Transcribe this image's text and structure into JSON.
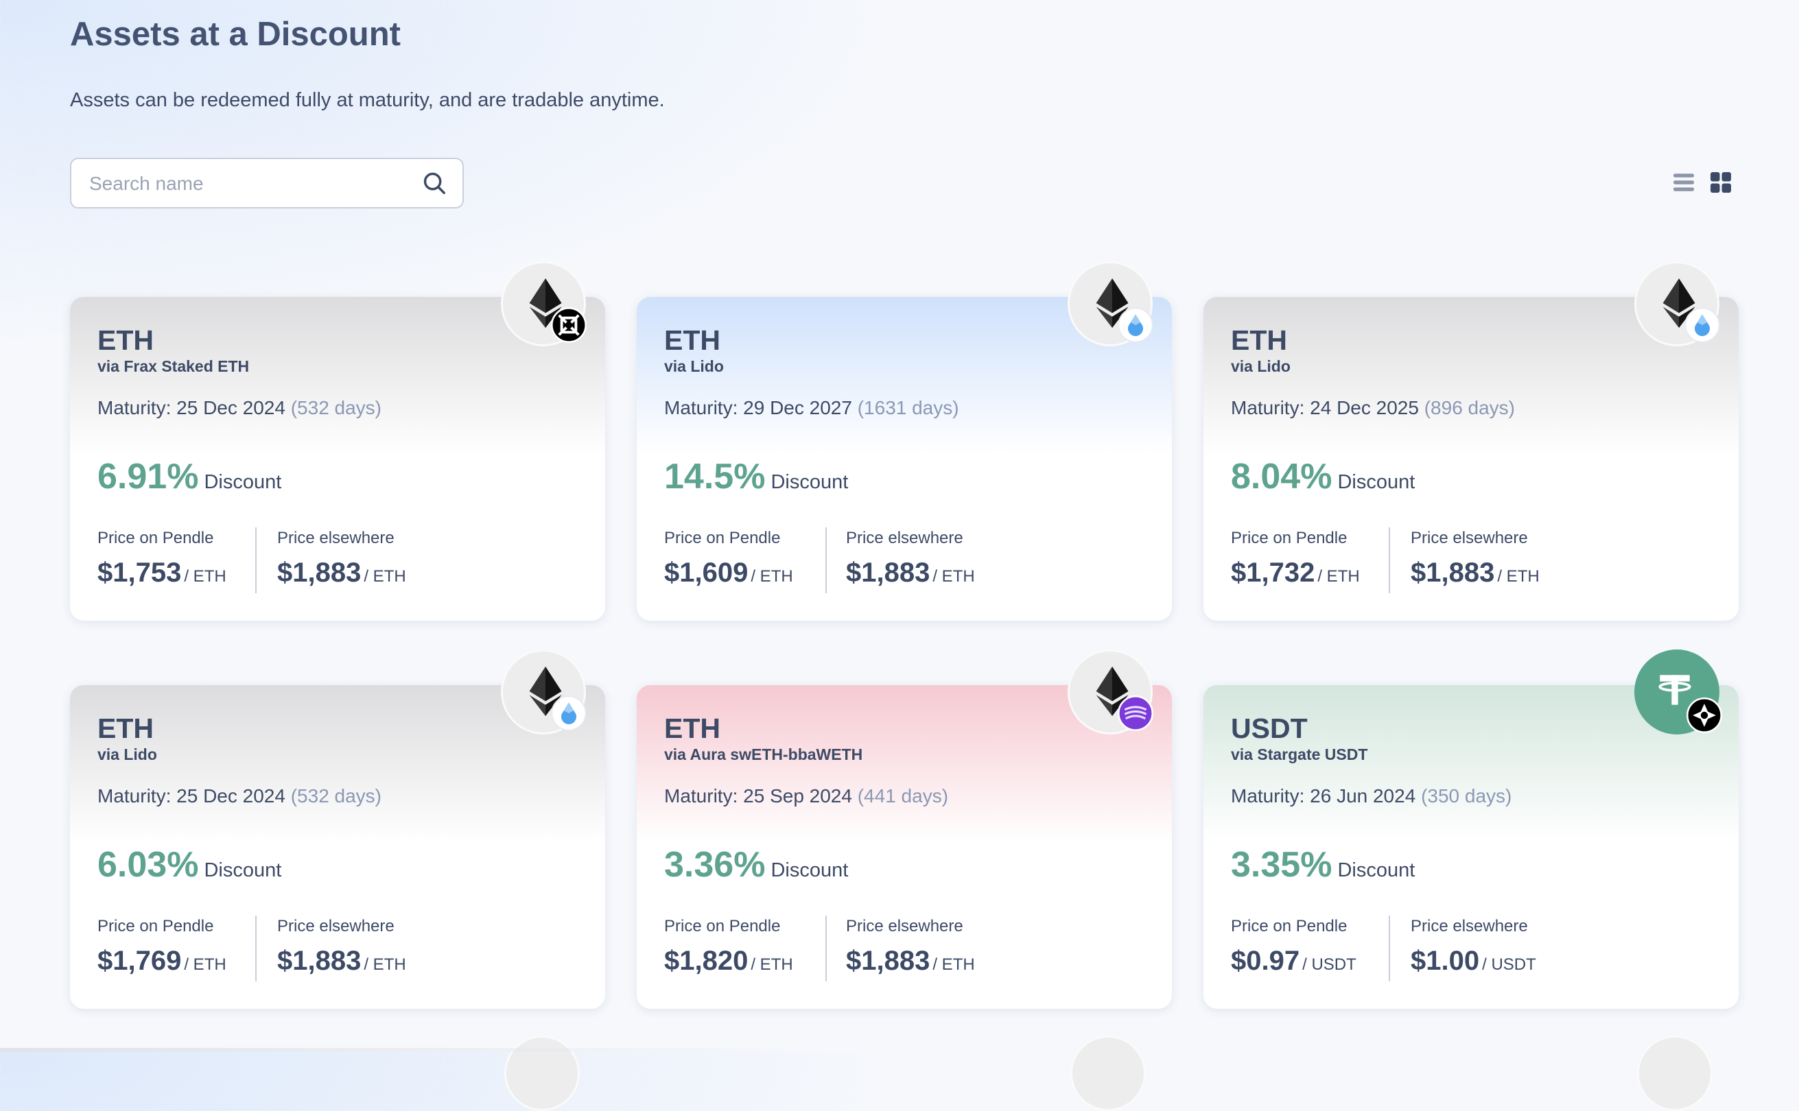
{
  "header": {
    "title": "Assets at a Discount",
    "subtitle": "Assets can be redeemed fully at maturity, and are tradable anytime."
  },
  "search": {
    "placeholder": "Search name",
    "value": ""
  },
  "view_toggle": {
    "list_icon": "list-view-icon",
    "grid_icon": "grid-view-icon",
    "active": "grid"
  },
  "labels": {
    "maturity_prefix": "Maturity: ",
    "discount": "Discount",
    "price_on_pendle": "Price on Pendle",
    "price_elsewhere": "Price elsewhere"
  },
  "colors": {
    "discount_green": "#5ea38f",
    "text": "#3d4a66",
    "days": "#8a98b4"
  },
  "cards": [
    {
      "asset": "ETH",
      "via": "via Frax Staked ETH",
      "maturity": "25 Dec 2024",
      "days": "(532 days)",
      "discount": "6.91%",
      "pendle_price": "$1,753",
      "elsewhere_price": "$1,883",
      "unit": "/ ETH",
      "icon": "eth-icon",
      "badge": "frax-icon",
      "theme": "gray"
    },
    {
      "asset": "ETH",
      "via": "via Lido",
      "maturity": "29 Dec 2027",
      "days": "(1631 days)",
      "discount": "14.5%",
      "pendle_price": "$1,609",
      "elsewhere_price": "$1,883",
      "unit": "/ ETH",
      "icon": "eth-icon",
      "badge": "lido-icon",
      "theme": "blue"
    },
    {
      "asset": "ETH",
      "via": "via Lido",
      "maturity": "24 Dec 2025",
      "days": "(896 days)",
      "discount": "8.04%",
      "pendle_price": "$1,732",
      "elsewhere_price": "$1,883",
      "unit": "/ ETH",
      "icon": "eth-icon",
      "badge": "lido-icon",
      "theme": "gray"
    },
    {
      "asset": "ETH",
      "via": "via Lido",
      "maturity": "25 Dec 2024",
      "days": "(532 days)",
      "discount": "6.03%",
      "pendle_price": "$1,769",
      "elsewhere_price": "$1,883",
      "unit": "/ ETH",
      "icon": "eth-icon",
      "badge": "lido-icon",
      "theme": "gray"
    },
    {
      "asset": "ETH",
      "via": "via Aura swETH-bbaWETH",
      "maturity": "25 Sep 2024",
      "days": "(441 days)",
      "discount": "3.36%",
      "pendle_price": "$1,820",
      "elsewhere_price": "$1,883",
      "unit": "/ ETH",
      "icon": "eth-icon",
      "badge": "aura-icon",
      "theme": "pink"
    },
    {
      "asset": "USDT",
      "via": "via Stargate USDT",
      "maturity": "26 Jun 2024",
      "days": "(350 days)",
      "discount": "3.35%",
      "pendle_price": "$0.97",
      "elsewhere_price": "$1.00",
      "unit": "/ USDT",
      "icon": "usdt-icon",
      "badge": "stargate-icon",
      "theme": "green"
    }
  ]
}
